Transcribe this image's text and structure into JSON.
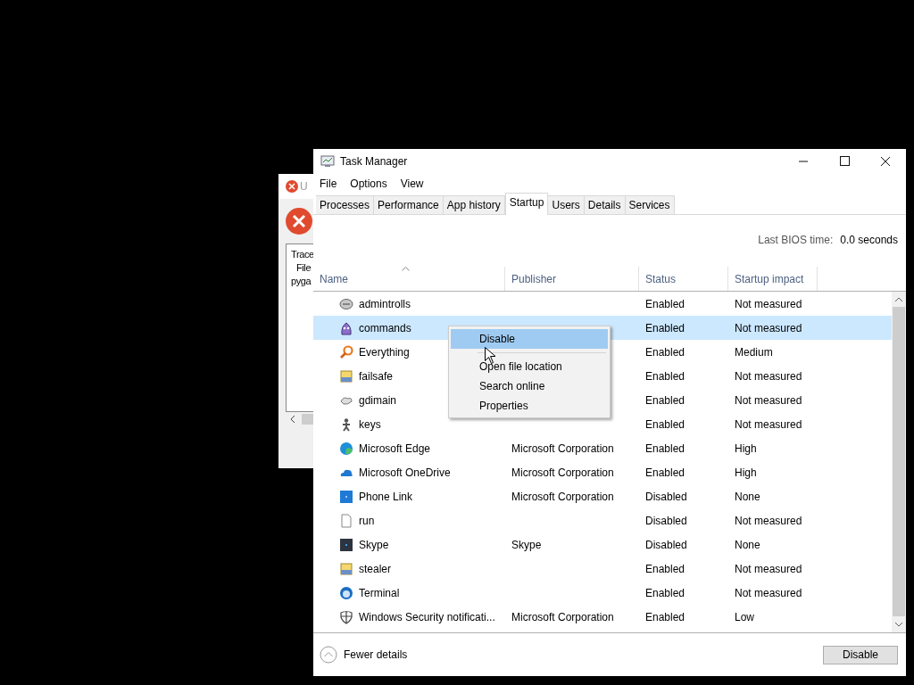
{
  "background_dialog": {
    "title": "U",
    "lines": [
      "Trace",
      "File",
      "pyga"
    ]
  },
  "window": {
    "title": "Task Manager"
  },
  "menu": [
    "File",
    "Options",
    "View"
  ],
  "tabs": [
    {
      "label": "Processes",
      "selected": false
    },
    {
      "label": "Performance",
      "selected": false
    },
    {
      "label": "App history",
      "selected": false
    },
    {
      "label": "Startup",
      "selected": true
    },
    {
      "label": "Users",
      "selected": false
    },
    {
      "label": "Details",
      "selected": false
    },
    {
      "label": "Services",
      "selected": false
    }
  ],
  "bios": {
    "label": "Last BIOS time:",
    "value": "0.0 seconds"
  },
  "columns": [
    {
      "label": "Name",
      "sorted": true
    },
    {
      "label": "Publisher",
      "sorted": false
    },
    {
      "label": "Status",
      "sorted": false
    },
    {
      "label": "Startup impact",
      "sorted": false
    }
  ],
  "rows": [
    {
      "name": "admintrolls",
      "publisher": "",
      "status": "Enabled",
      "impact": "Not measured",
      "selected": false
    },
    {
      "name": "commands",
      "publisher": "",
      "status": "Enabled",
      "impact": "Not measured",
      "selected": true
    },
    {
      "name": "Everything",
      "publisher": "",
      "status": "Enabled",
      "impact": "Medium",
      "selected": false
    },
    {
      "name": "failsafe",
      "publisher": "",
      "status": "Enabled",
      "impact": "Not measured",
      "selected": false
    },
    {
      "name": "gdimain",
      "publisher": "",
      "status": "Enabled",
      "impact": "Not measured",
      "selected": false
    },
    {
      "name": "keys",
      "publisher": "",
      "status": "Enabled",
      "impact": "Not measured",
      "selected": false
    },
    {
      "name": "Microsoft Edge",
      "publisher": "Microsoft Corporation",
      "status": "Enabled",
      "impact": "High",
      "selected": false
    },
    {
      "name": "Microsoft OneDrive",
      "publisher": "Microsoft Corporation",
      "status": "Enabled",
      "impact": "High",
      "selected": false
    },
    {
      "name": "Phone Link",
      "publisher": "Microsoft Corporation",
      "status": "Disabled",
      "impact": "None",
      "selected": false
    },
    {
      "name": "run",
      "publisher": "",
      "status": "Disabled",
      "impact": "Not measured",
      "selected": false
    },
    {
      "name": "Skype",
      "publisher": "Skype",
      "status": "Disabled",
      "impact": "None",
      "selected": false
    },
    {
      "name": "stealer",
      "publisher": "",
      "status": "Enabled",
      "impact": "Not measured",
      "selected": false
    },
    {
      "name": "Terminal",
      "publisher": "",
      "status": "Enabled",
      "impact": "Not measured",
      "selected": false
    },
    {
      "name": "Windows Security notificati...",
      "publisher": "Microsoft Corporation",
      "status": "Enabled",
      "impact": "Low",
      "selected": false
    }
  ],
  "context_menu": [
    {
      "label": "Disable",
      "selected": true,
      "separator_after": true
    },
    {
      "label": "Open file location",
      "selected": false,
      "separator_after": false
    },
    {
      "label": "Search online",
      "selected": false,
      "separator_after": false
    },
    {
      "label": "Properties",
      "selected": false,
      "separator_after": false
    }
  ],
  "footer": {
    "details_link": "Fewer details",
    "button": "Disable"
  }
}
